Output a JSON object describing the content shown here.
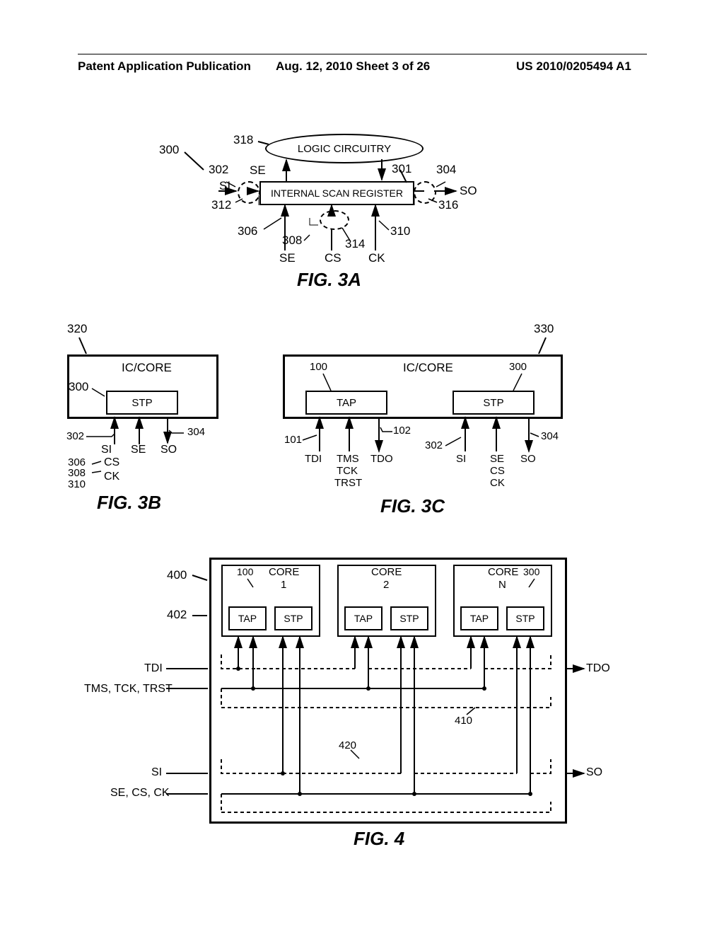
{
  "header": {
    "left": "Patent Application Publication",
    "middle": "Aug. 12, 2010  Sheet 3 of 26",
    "right": "US 2010/0205494 A1"
  },
  "fig3a": {
    "caption": "FIG. 3A",
    "ref300": "300",
    "ref318": "318",
    "logic": "LOGIC CIRCUITRY",
    "register": "INTERNAL SCAN REGISTER",
    "ref302": "302",
    "ref301": "301",
    "ref304": "304",
    "ref312": "312",
    "ref316": "316",
    "ref306": "306",
    "ref308": "308",
    "ref310": "310",
    "ref314": "314",
    "SI": "SI",
    "SO": "SO",
    "SE_top": "SE",
    "SE_bot": "SE",
    "CS": "CS",
    "CK": "CK"
  },
  "fig3b": {
    "caption": "FIG. 3B",
    "ref320": "320",
    "ref300": "300",
    "ref302": "302",
    "ref304": "304",
    "ref306": "306",
    "ref308": "308",
    "ref310": "310",
    "IC": "IC/CORE",
    "STP": "STP",
    "sigSI": "SI",
    "sigSE": "SE",
    "sigSO": "SO",
    "sigCS": "CS",
    "sigCK": "CK"
  },
  "fig3c": {
    "caption": "FIG. 3C",
    "ref330": "330",
    "ref100": "100",
    "ref300": "300",
    "ref101": "101",
    "ref102": "102",
    "ref302": "302",
    "ref304": "304",
    "IC": "IC/CORE",
    "TAP": "TAP",
    "STP": "STP",
    "sigTDI": "TDI",
    "sigTMS": "TMS",
    "sigTDO": "TDO",
    "sigTCK": "TCK",
    "sigTRST": "TRST",
    "sigSI": "SI",
    "sigSE": "SE",
    "sigSO": "SO",
    "sigCS": "CS",
    "sigCK": "CK"
  },
  "fig4": {
    "caption": "FIG. 4",
    "ref400": "400",
    "ref402": "402",
    "ref100": "100",
    "ref300": "300",
    "ref410": "410",
    "ref420": "420",
    "core1": "CORE",
    "core1n": "1",
    "core2": "CORE",
    "core2n": "2",
    "coreN": "CORE",
    "coreNn": "N",
    "TAP": "TAP",
    "STP": "STP",
    "sigTDI": "TDI",
    "sigTDO": "TDO",
    "sigTMS": "TMS, TCK, TRST",
    "sigSI": "SI",
    "sigSO": "SO",
    "sigSE": "SE, CS, CK"
  }
}
